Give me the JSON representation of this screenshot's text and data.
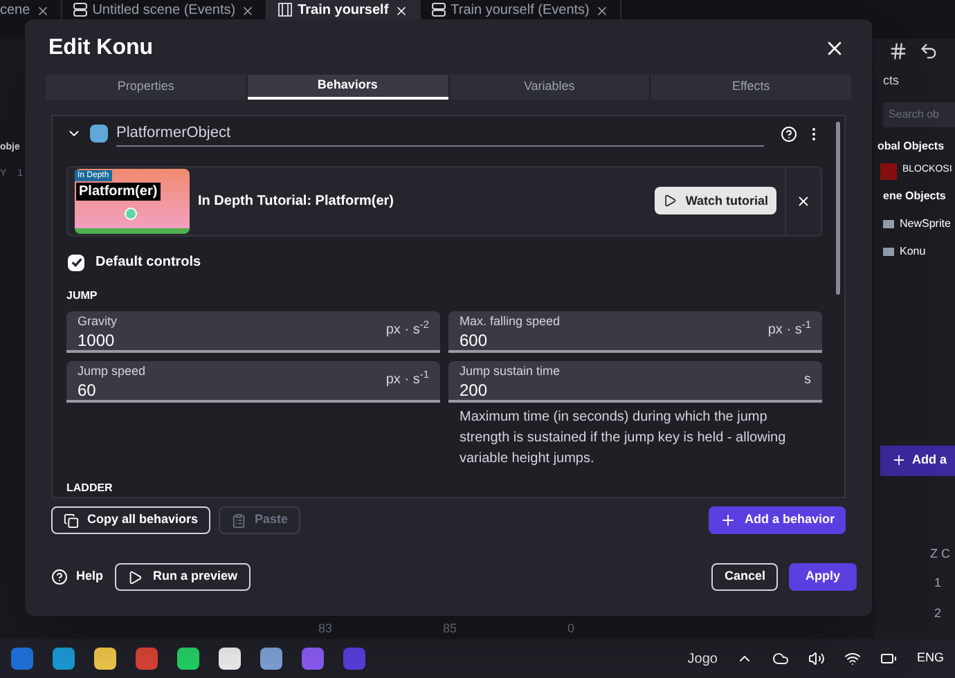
{
  "editor_tabs": [
    {
      "label": "cene",
      "selected": false
    },
    {
      "label": "Untitled scene (Events)",
      "selected": false,
      "kind": "events"
    },
    {
      "label": "Train yourself",
      "selected": true,
      "kind": "scene"
    },
    {
      "label": "Train yourself (Events)",
      "selected": false,
      "kind": "events"
    }
  ],
  "left_panel": {
    "header": "obje",
    "row_label": "Y",
    "row_value": "1"
  },
  "right_panel": {
    "header": "cts",
    "search": {
      "placeholder": "Search ob"
    },
    "global_title": "obal Objects",
    "global_objects": [
      {
        "name": "BLOCKOSI",
        "color": "#8b0f0f"
      }
    ],
    "scene_title": "ene Objects",
    "scene_objects": [
      {
        "name": "NewSprite"
      },
      {
        "name": "Konu"
      }
    ],
    "add_button": "Add a",
    "column_header": "Z C",
    "column_values": [
      "1",
      "2"
    ]
  },
  "instances_row": [
    "83",
    "85",
    "0"
  ],
  "dialog": {
    "title": "Edit Konu",
    "tabs": [
      {
        "label": "Properties",
        "selected": false
      },
      {
        "label": "Behaviors",
        "selected": true
      },
      {
        "label": "Variables",
        "selected": false
      },
      {
        "label": "Effects",
        "selected": false
      }
    ],
    "behavior": {
      "name": "PlatformerObject",
      "expanded": true,
      "tutorial": {
        "tag": "In Depth",
        "thumbnail_title": "Platform(er)",
        "title": "In Depth Tutorial: Platform(er)",
        "button": "Watch tutorial"
      },
      "checkbox": {
        "label": "Default controls",
        "checked": true
      },
      "section": "JUMP",
      "fields": [
        {
          "label": "Gravity",
          "value": "1000",
          "unit": "px · s$^{-2}$"
        },
        {
          "label": "Max. falling speed",
          "value": "600",
          "unit": "px · s$^{-1}$"
        },
        {
          "label": "Jump speed",
          "value": "60",
          "unit": "px · s$^{-1}$"
        },
        {
          "label": "Jump sustain time",
          "value": "200",
          "unit": "s",
          "help": "Maximum time (in seconds) during which the jump strength is sustained if the jump key is held - allowing variable height jumps."
        }
      ],
      "next_section": "LADDER"
    },
    "copy_button": "Copy all behaviors",
    "paste_button": {
      "label": "Paste",
      "disabled": true
    },
    "add_button": "Add a behavior",
    "help_button": "Help",
    "preview_button": "Run a preview",
    "cancel_button": "Cancel",
    "apply_button": "Apply"
  },
  "taskbar": {
    "weather": "Jogo",
    "language": "ENG"
  }
}
